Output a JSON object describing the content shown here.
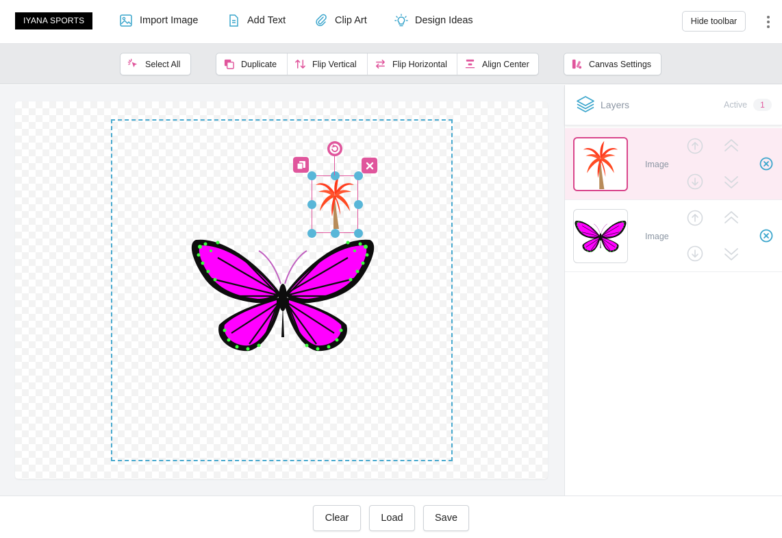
{
  "brand": "IYANA SPORTS",
  "topnav": {
    "import_image": "Import Image",
    "add_text": "Add Text",
    "clip_art": "Clip Art",
    "design_ideas": "Design Ideas",
    "hide_toolbar": "Hide toolbar"
  },
  "toolbar": {
    "select_all": "Select All",
    "duplicate": "Duplicate",
    "flip_vertical": "Flip Vertical",
    "flip_horizontal": "Flip Horizontal",
    "align_center": "Align Center",
    "canvas_settings": "Canvas Settings"
  },
  "canvas": {
    "objects": [
      {
        "name": "palm-tree-image",
        "selected": true
      },
      {
        "name": "butterfly-image",
        "selected": false
      }
    ]
  },
  "layers": {
    "title": "Layers",
    "active_label": "Active",
    "active_count": "1",
    "items": [
      {
        "type": "Image",
        "thumb_icon": "palm-tree",
        "active": true
      },
      {
        "type": "Image",
        "thumb_icon": "butterfly",
        "active": false
      }
    ]
  },
  "footer": {
    "clear": "Clear",
    "load": "Load",
    "save": "Save"
  },
  "colors": {
    "accent_pink": "#e0559c",
    "handle_blue": "#58b6d8",
    "design_border": "#47a9cf",
    "butterfly_magenta": "#ff00ff",
    "palm_red": "#ff3d1f"
  }
}
